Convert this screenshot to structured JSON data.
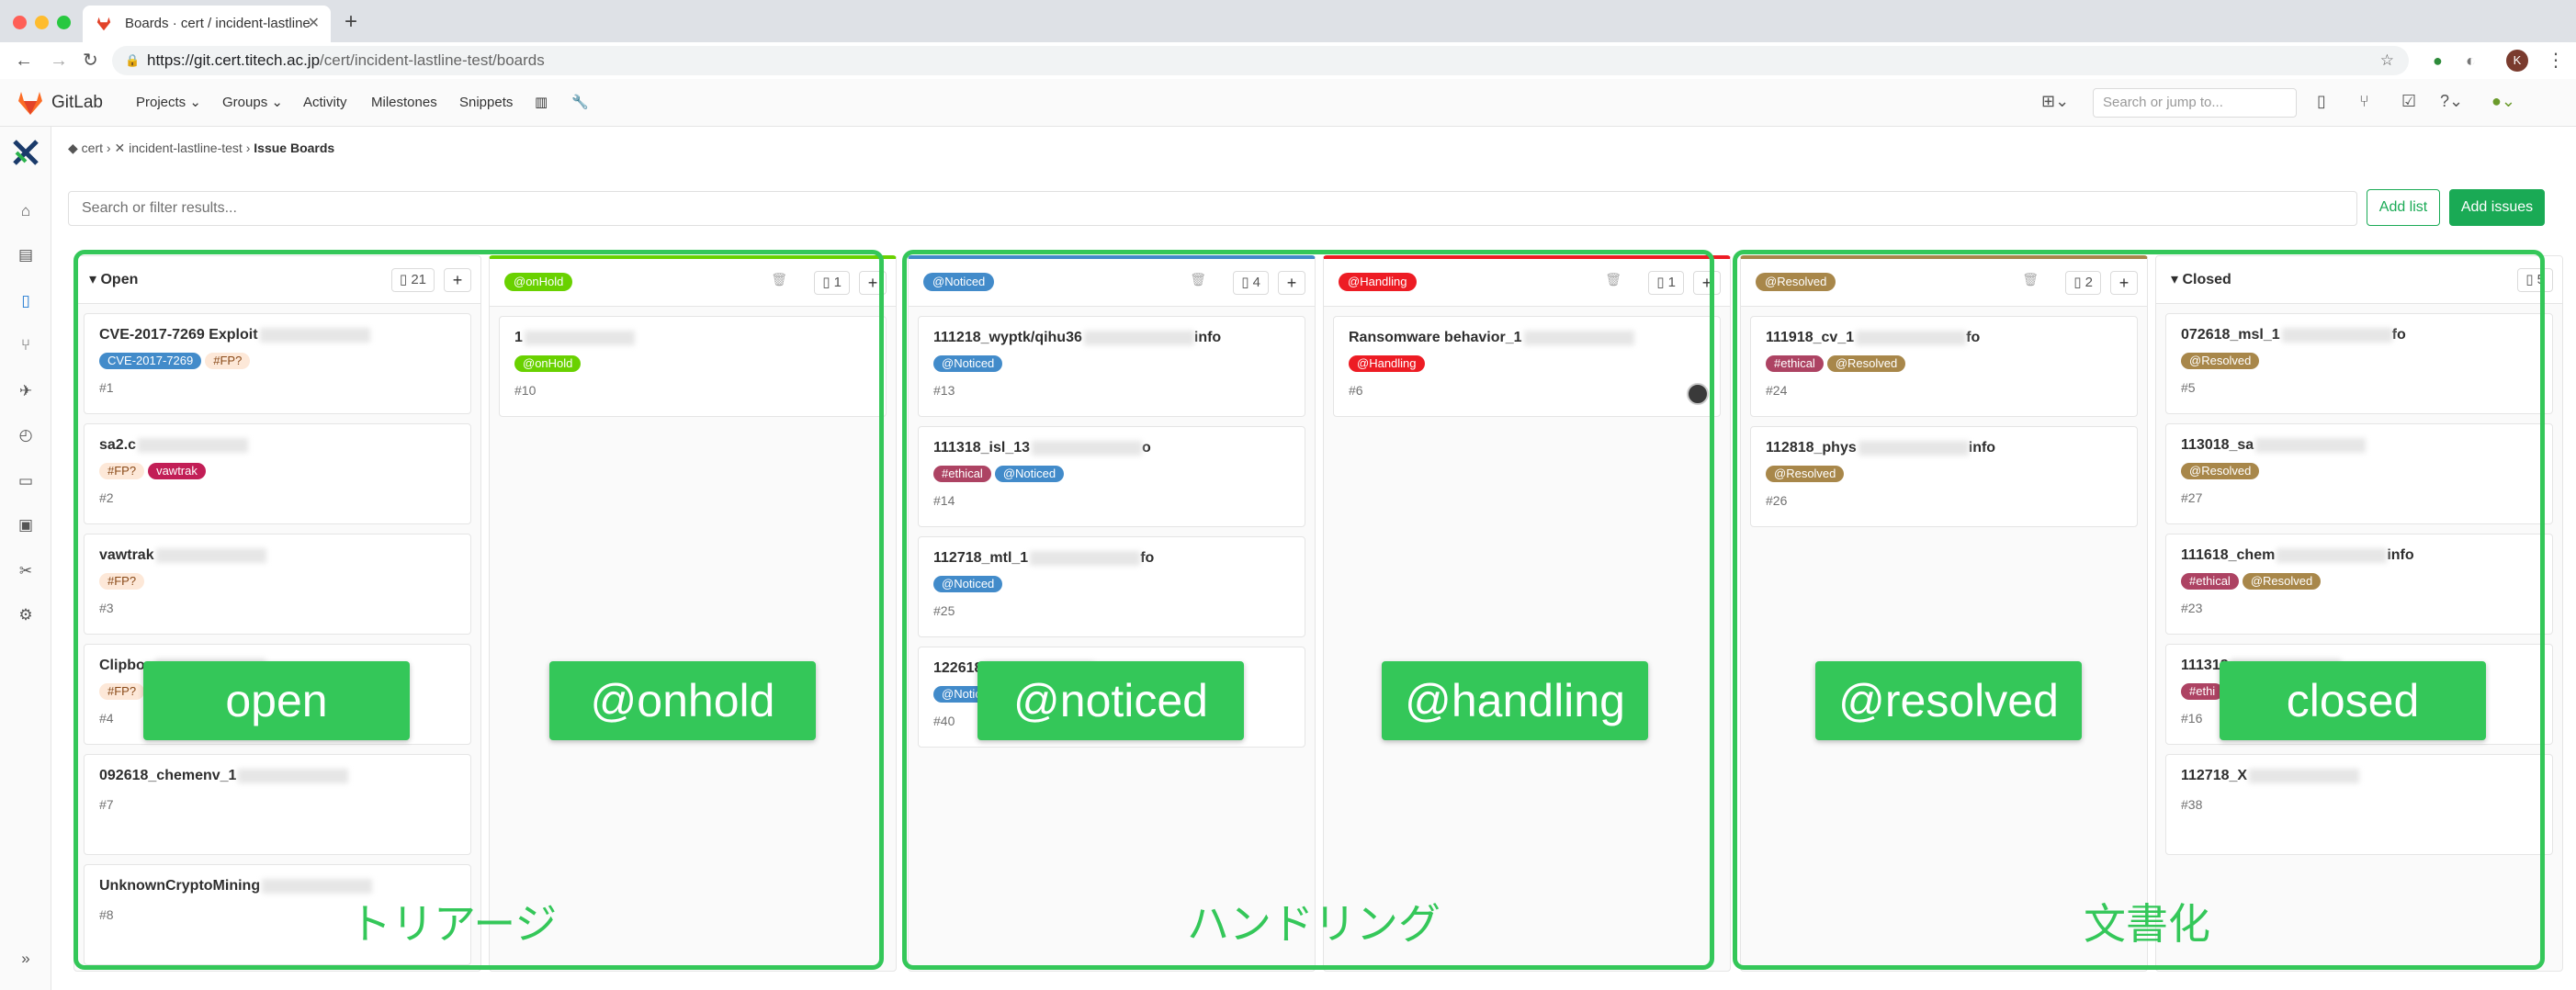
{
  "browser": {
    "tab_title": "Boards · cert / incident-lastline",
    "url_host": "https://git.cert.titech.ac.jp",
    "url_path": "/cert/incident-lastline-test/boards",
    "profile_initial": "K"
  },
  "gitlab": {
    "brand": "GitLab",
    "nav": [
      "Projects",
      "Groups",
      "Activity",
      "Milestones",
      "Snippets"
    ],
    "search_placeholder": "Search or jump to..."
  },
  "breadcrumb": {
    "group": "cert",
    "project": "incident-lastline-test",
    "page": "Issue Boards"
  },
  "filter_placeholder": "Search or filter results...",
  "buttons": {
    "add_list": "Add list",
    "add_issues": "Add issues"
  },
  "lists": [
    {
      "title": "Open",
      "count": "21",
      "cards": [
        {
          "title": "CVE-2017-7269 Exploit",
          "num": "#1",
          "labels": [
            {
              "text": "CVE-2017-7269",
              "color": "#428bca",
              "fg": "#ffffff"
            },
            {
              "text": "#FP?",
              "color": "#fde8d8",
              "fg": "#8a4b1a"
            }
          ]
        },
        {
          "title": "sa2.c",
          "num": "#2",
          "labels": [
            {
              "text": "#FP?",
              "color": "#fde8d8",
              "fg": "#8a4b1a"
            },
            {
              "text": "vawtrak",
              "color": "#c21e56",
              "fg": "#ffffff"
            }
          ]
        },
        {
          "title": "vawtrak",
          "num": "#3",
          "labels": [
            {
              "text": "#FP?",
              "color": "#fde8d8",
              "fg": "#8a4b1a"
            }
          ]
        },
        {
          "title": "Clipboa",
          "num": "#4",
          "labels": [
            {
              "text": "#FP?",
              "color": "#fde8d8",
              "fg": "#8a4b1a"
            }
          ]
        },
        {
          "title": "092618_chemenv_1",
          "num": "#7",
          "labels": []
        },
        {
          "title": "UnknownCryptoMining",
          "num": "#8",
          "labels": []
        }
      ]
    },
    {
      "title": "@onHold",
      "count": "1",
      "pill_color": "#69d100",
      "cards": [
        {
          "title": "1",
          "num": "#10",
          "labels": [
            {
              "text": "@onHold",
              "color": "#69d100",
              "fg": "#ffffff"
            }
          ]
        }
      ]
    },
    {
      "title": "@Noticed",
      "count": "4",
      "pill_color": "#428bca",
      "cards": [
        {
          "title": "111218_wyptk/qihu36",
          "suffix": "info",
          "num": "#13",
          "labels": [
            {
              "text": "@Noticed",
              "color": "#428bca",
              "fg": "#ffffff"
            }
          ]
        },
        {
          "title": "111318_isl_13",
          "suffix": "o",
          "num": "#14",
          "labels": [
            {
              "text": "#ethical",
              "color": "#ad4363",
              "fg": "#ffffff"
            },
            {
              "text": "@Noticed",
              "color": "#428bca",
              "fg": "#ffffff"
            }
          ]
        },
        {
          "title": "112718_mtl_1",
          "suffix": "fo",
          "num": "#25",
          "labels": [
            {
              "text": "@Noticed",
              "color": "#428bca",
              "fg": "#ffffff"
            }
          ]
        },
        {
          "title": "122618",
          "num": "#40",
          "labels": [
            {
              "text": "@Notic",
              "color": "#428bca",
              "fg": "#ffffff"
            }
          ]
        }
      ]
    },
    {
      "title": "@Handling",
      "count": "1",
      "pill_color": "#ed1c24",
      "cards": [
        {
          "title": "Ransomware behavior_1",
          "num": "#6",
          "labels": [
            {
              "text": "@Handling",
              "color": "#ed1c24",
              "fg": "#ffffff"
            }
          ],
          "avatar": true
        }
      ]
    },
    {
      "title": "@Resolved",
      "count": "2",
      "pill_color": "#a8874a",
      "cards": [
        {
          "title": "111918_cv_1",
          "suffix": "fo",
          "num": "#24",
          "labels": [
            {
              "text": "#ethical",
              "color": "#ad4363",
              "fg": "#ffffff"
            },
            {
              "text": "@Resolved",
              "color": "#a8874a",
              "fg": "#ffffff"
            }
          ]
        },
        {
          "title": "112818_phys",
          "suffix": "info",
          "num": "#26",
          "labels": [
            {
              "text": "@Resolved",
              "color": "#a8874a",
              "fg": "#ffffff"
            }
          ]
        }
      ]
    },
    {
      "title": "Closed",
      "count": "5",
      "cards": [
        {
          "title": "072618_msl_1",
          "suffix": "fo",
          "num": "#5",
          "labels": [
            {
              "text": "@Resolved",
              "color": "#a8874a",
              "fg": "#ffffff"
            }
          ]
        },
        {
          "title": "113018_sa",
          "num": "#27",
          "labels": [
            {
              "text": "@Resolved",
              "color": "#a8874a",
              "fg": "#ffffff"
            }
          ]
        },
        {
          "title": "111618_chem",
          "suffix": "info",
          "num": "#23",
          "labels": [
            {
              "text": "#ethical",
              "color": "#ad4363",
              "fg": "#ffffff"
            },
            {
              "text": "@Resolved",
              "color": "#a8874a",
              "fg": "#ffffff"
            }
          ]
        },
        {
          "title": "111318",
          "num": "#16",
          "labels": [
            {
              "text": "#ethi",
              "color": "#ad4363",
              "fg": "#ffffff"
            }
          ]
        },
        {
          "title": "112718_X",
          "num": "#38",
          "labels": []
        }
      ]
    }
  ],
  "overlays": [
    "open",
    "@onhold",
    "@noticed",
    "@handling",
    "@resolved",
    "closed"
  ],
  "groups": [
    "トリアージ",
    "ハンドリング",
    "文書化"
  ],
  "accent": "#34c759"
}
